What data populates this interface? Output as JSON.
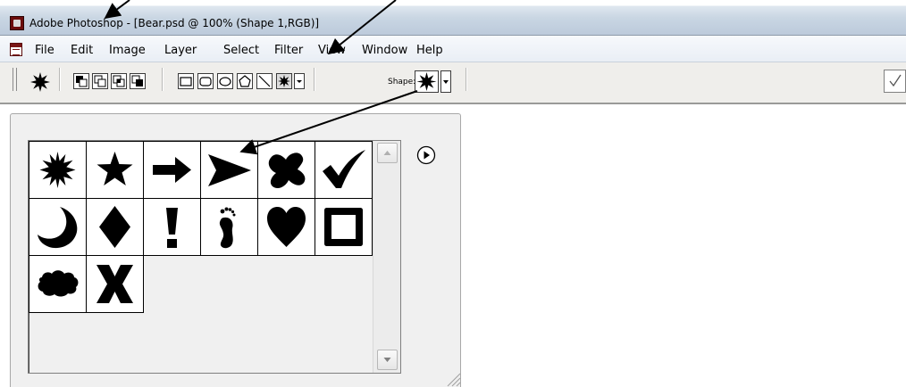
{
  "window": {
    "title": "Adobe Photoshop - [Bear.psd @ 100% (Shape 1,RGB)]",
    "app_icon": "photoshop-icon"
  },
  "menubar": {
    "document_icon": "document-icon",
    "items": [
      {
        "label": "File"
      },
      {
        "label": "Edit"
      },
      {
        "label": "Image"
      },
      {
        "label": "Layer"
      },
      {
        "label": "Select"
      },
      {
        "label": "Filter"
      },
      {
        "label": "View"
      },
      {
        "label": "Window"
      },
      {
        "label": "Help"
      }
    ]
  },
  "options_bar": {
    "shape_label": "Shape:",
    "tool_icons": [
      "starburst-icon",
      "shape-layers-icon",
      "paths-icon",
      "fill-pixels-icon",
      "combine-icon",
      "rectangle-icon",
      "rounded-rectangle-icon",
      "ellipse-icon",
      "polygon-icon",
      "line-icon",
      "custom-shape-icon",
      "dropdown-arrow-icon"
    ],
    "selected_shape_icon": "starburst-icon",
    "commit_icon": "checkmark-icon"
  },
  "shape_picker": {
    "shapes": [
      {
        "name": "starburst"
      },
      {
        "name": "star"
      },
      {
        "name": "arrow"
      },
      {
        "name": "arrowhead"
      },
      {
        "name": "splat"
      },
      {
        "name": "checkmark"
      },
      {
        "name": "crescent-moon"
      },
      {
        "name": "diamond"
      },
      {
        "name": "exclamation"
      },
      {
        "name": "footprint"
      },
      {
        "name": "heart"
      },
      {
        "name": "square-frame"
      },
      {
        "name": "cloud"
      },
      {
        "name": "x-mark"
      }
    ],
    "menu_icon": "panel-menu-arrow-icon",
    "scroll_up_icon": "scroll-up-icon",
    "scroll_down_icon": "scroll-down-icon"
  },
  "colors": {
    "titlebar": "#c9d6e3",
    "toolbar": "#efeeeb",
    "panel": "#f0f0f0",
    "shape_fill": "#000000"
  }
}
